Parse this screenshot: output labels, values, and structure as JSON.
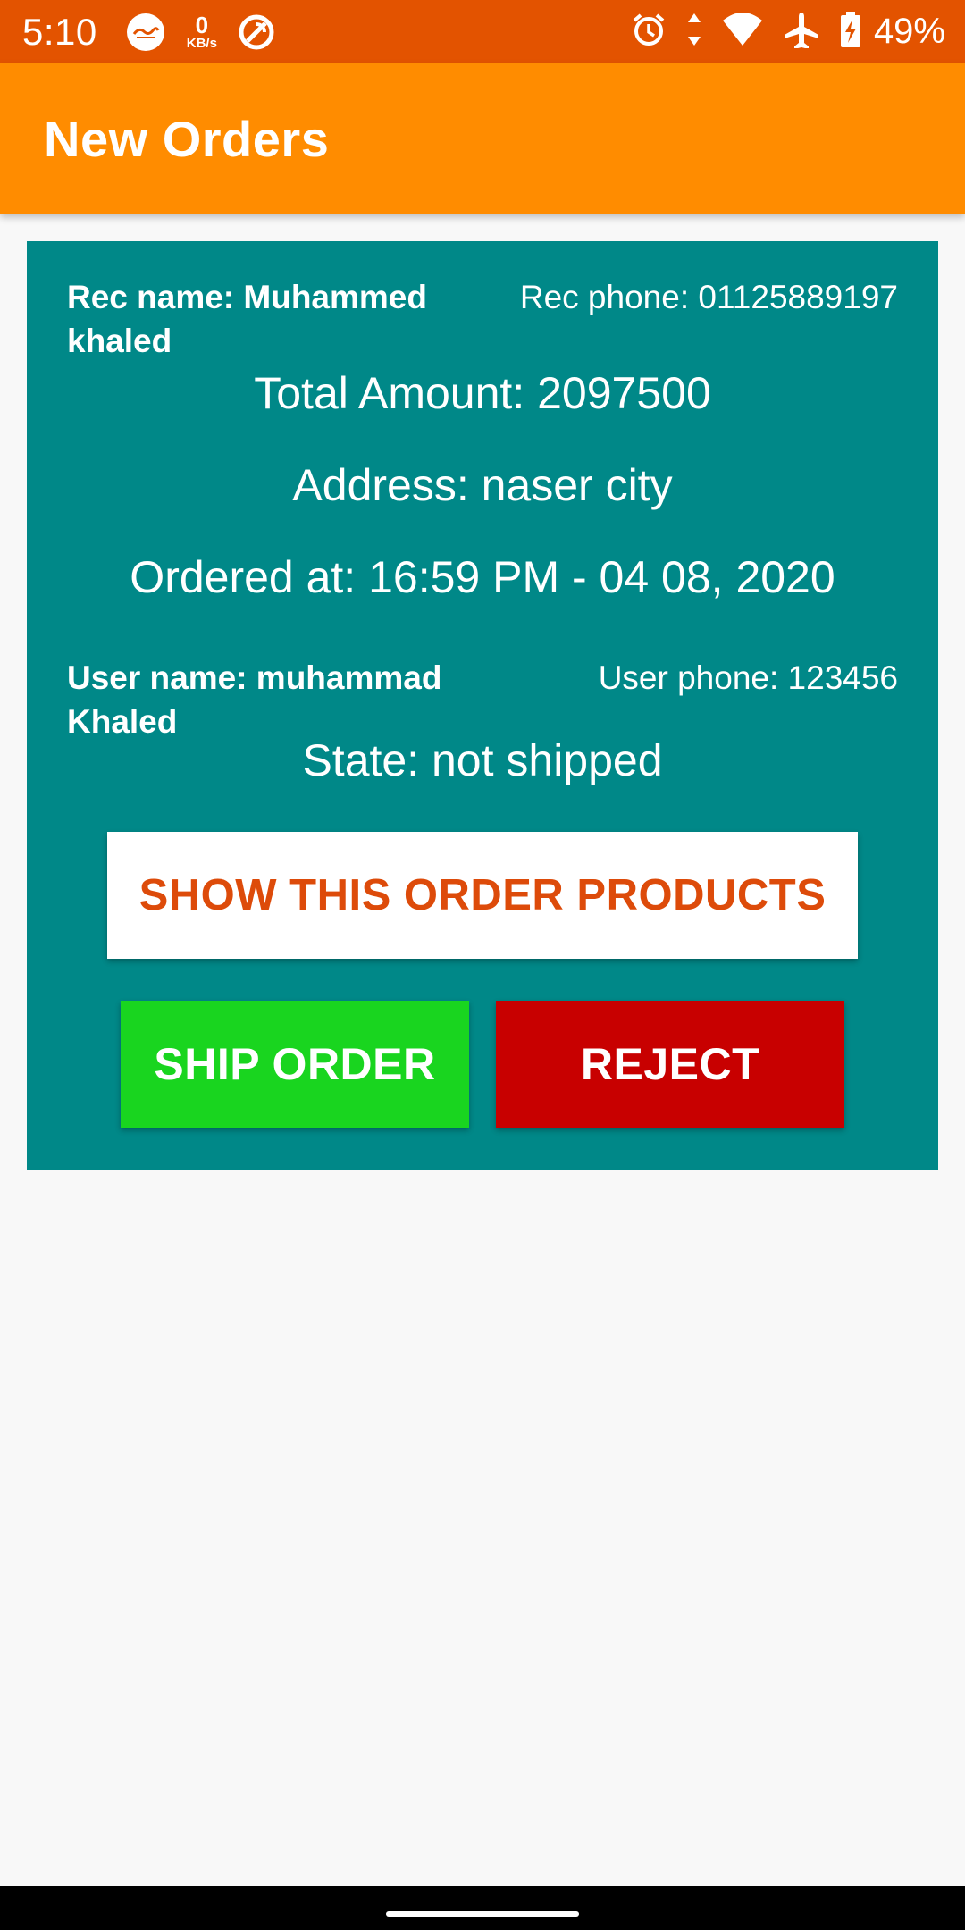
{
  "status_bar": {
    "time": "5:10",
    "net_speed_value": "0",
    "net_speed_unit": "KB/s",
    "battery_percent": "49%",
    "icons": [
      "quran-app-icon",
      "speed-icon",
      "data-saver-icon",
      "alarm-icon",
      "data-arrows-icon",
      "wifi-icon",
      "airplane-icon",
      "battery-charging-icon"
    ],
    "background_color": "#e35300"
  },
  "app_bar": {
    "title": "New Orders",
    "background_color": "#ff8c00"
  },
  "order": {
    "rec_name": "Rec name: Muhammed khaled",
    "rec_phone": "Rec phone: 01125889197",
    "total_amount": "Total Amount: 2097500",
    "address": "Address: naser city",
    "ordered_at": "Ordered at: 16:59 PM - 04 08, 2020",
    "user_name": "User name: muhammad Khaled",
    "user_phone": "User phone: 123456",
    "state": "State: not shipped",
    "card_color": "#008888"
  },
  "buttons": {
    "show_products": "SHOW THIS ORDER PRODUCTS",
    "ship_order": "SHIP ORDER",
    "reject": "REJECT",
    "ship_color": "#19d51f",
    "reject_color": "#c80000"
  }
}
